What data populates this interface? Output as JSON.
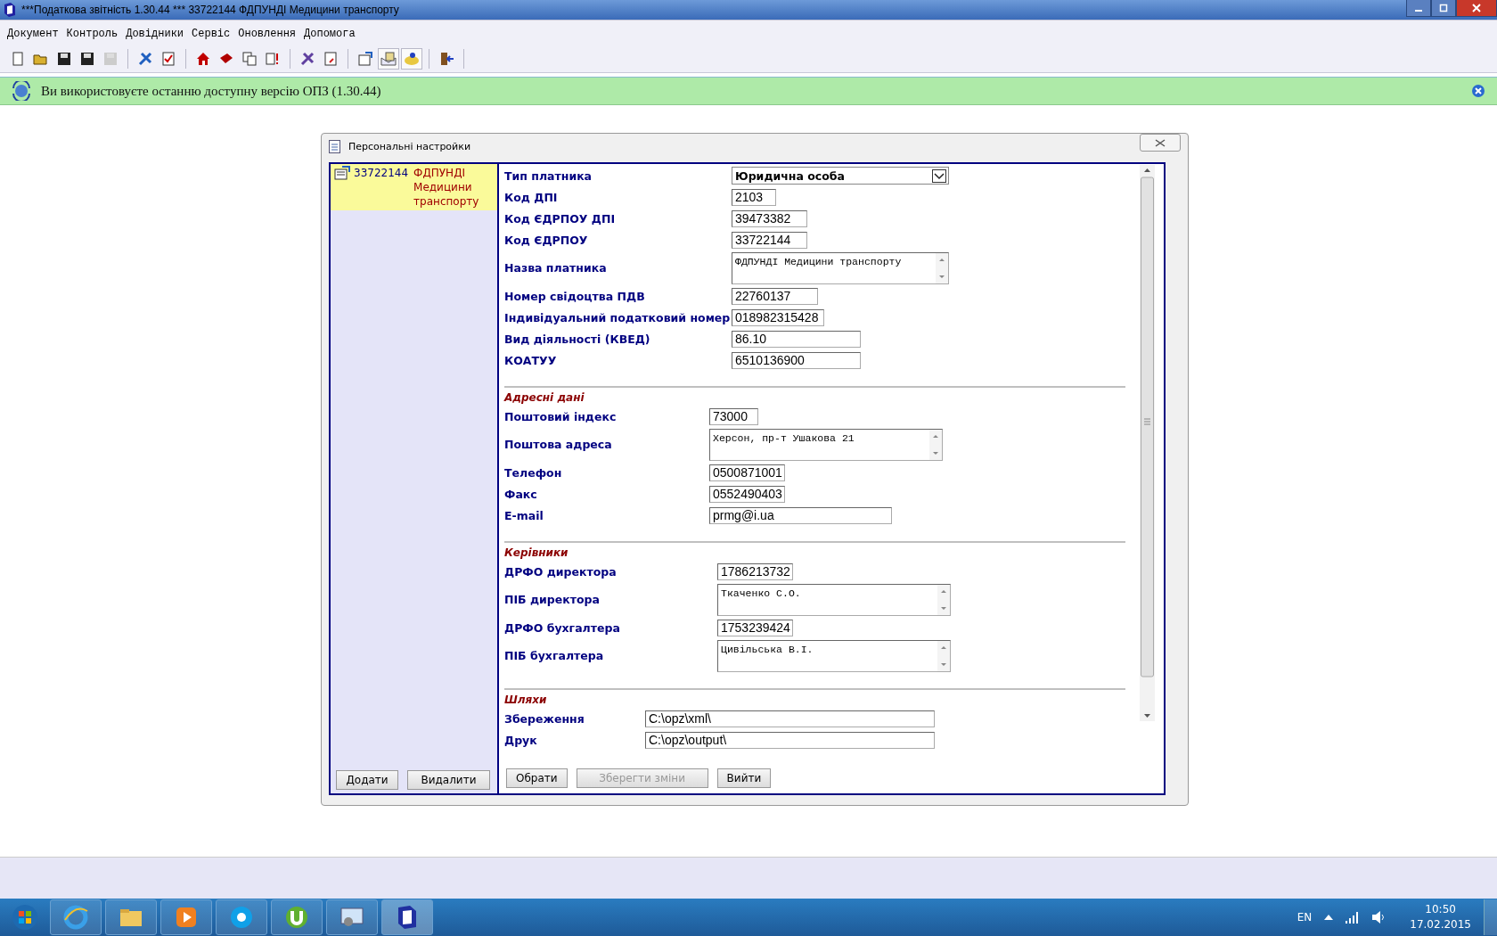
{
  "window": {
    "title": "***Податкова звітність 1.30.44 *** 33722144 ФДПУНДІ Медицини транспорту"
  },
  "menu": [
    "Документ",
    "Контроль",
    "Довідники",
    "Сервіс",
    "Оновлення",
    "Допомога"
  ],
  "toolbar": [
    [
      {
        "pressed": false
      },
      {
        "pressed": false
      },
      {
        "pressed": false
      },
      {
        "pressed": false
      },
      {
        "pressed": false
      }
    ],
    [
      {
        "pressed": false
      },
      {
        "pressed": false
      }
    ],
    [
      {
        "pressed": false
      },
      {
        "pressed": false
      },
      {
        "pressed": false
      },
      {
        "pressed": false
      }
    ],
    [
      {
        "pressed": false
      },
      {
        "pressed": false
      }
    ],
    [
      {
        "pressed": false
      },
      {
        "pressed": true
      },
      {
        "pressed": true
      }
    ],
    [
      {
        "pressed": false
      }
    ]
  ],
  "banner": {
    "text": "Ви використовуєте останню доступну версію ОПЗ (1.30.44)"
  },
  "dialog": {
    "title": "Персональні настройки",
    "payers": [
      {
        "code": "33722144",
        "name": "ФДПУНДІ Медицини транспорту",
        "selected": true
      }
    ],
    "sections": [
      {
        "fields": [
          {
            "label": "Тип платника",
            "kind": "select",
            "value": "Юридична особа"
          },
          {
            "label": "Код ДПІ",
            "kind": "text",
            "value": "2103"
          },
          {
            "label": "Код ЄДРПОУ ДПІ",
            "kind": "text",
            "value": "39473382"
          },
          {
            "label": "Код ЄДРПОУ",
            "kind": "text",
            "value": "33722144"
          },
          {
            "label": "Назва платника",
            "kind": "memo",
            "value": "ФДПУНДІ Медицини транспорту"
          },
          {
            "label": "Номер свідоцтва ПДВ",
            "kind": "text",
            "value": "22760137"
          },
          {
            "label": "Індивідуальний податковий номер",
            "kind": "text",
            "value": "018982315428"
          },
          {
            "label": "Вид діяльності (КВЕД)",
            "kind": "text",
            "value": "86.10"
          },
          {
            "label": "КОАТУУ",
            "kind": "text",
            "value": "6510136900"
          }
        ]
      },
      {
        "title": "Адресні дані",
        "fields": [
          {
            "label": "Поштовий індекс",
            "kind": "text",
            "value": "73000"
          },
          {
            "label": "Поштова адреса",
            "kind": "memo",
            "value": "Херсон, пр-т Ушакова 21"
          },
          {
            "label": "Телефон",
            "kind": "text",
            "value": "0500871001"
          },
          {
            "label": "Факс",
            "kind": "text",
            "value": "0552490403"
          },
          {
            "label": "E-mail",
            "kind": "text",
            "value": "prmg@i.ua"
          }
        ]
      },
      {
        "title": "Керівники",
        "fields": [
          {
            "label": "ДРФО директора",
            "kind": "text",
            "value": "1786213732"
          },
          {
            "label": "ПІБ директора",
            "kind": "memo",
            "value": "Ткаченко С.О."
          },
          {
            "label": "ДРФО бухгалтера",
            "kind": "text",
            "value": "1753239424"
          },
          {
            "label": "ПІБ бухгалтера",
            "kind": "memo",
            "value": "Цивільська В.І."
          }
        ]
      },
      {
        "title": "Шляхи",
        "fields": [
          {
            "label": "Збереження",
            "kind": "text",
            "value": "C:\\opz\\xml\\"
          },
          {
            "label": "Друк",
            "kind": "text",
            "value": "C:\\opz\\output\\"
          }
        ]
      }
    ],
    "list_buttons": [
      {
        "label": "Додати",
        "disabled": false
      },
      {
        "label": "Видалити",
        "disabled": false
      }
    ],
    "buttons": [
      {
        "label": "Обрати",
        "disabled": false
      },
      {
        "label": "Зберегти зміни",
        "disabled": true
      },
      {
        "label": "Вийти",
        "disabled": false
      }
    ]
  },
  "taskbar": {
    "language": "EN",
    "time": "10:50",
    "date": "17.02.2015"
  }
}
